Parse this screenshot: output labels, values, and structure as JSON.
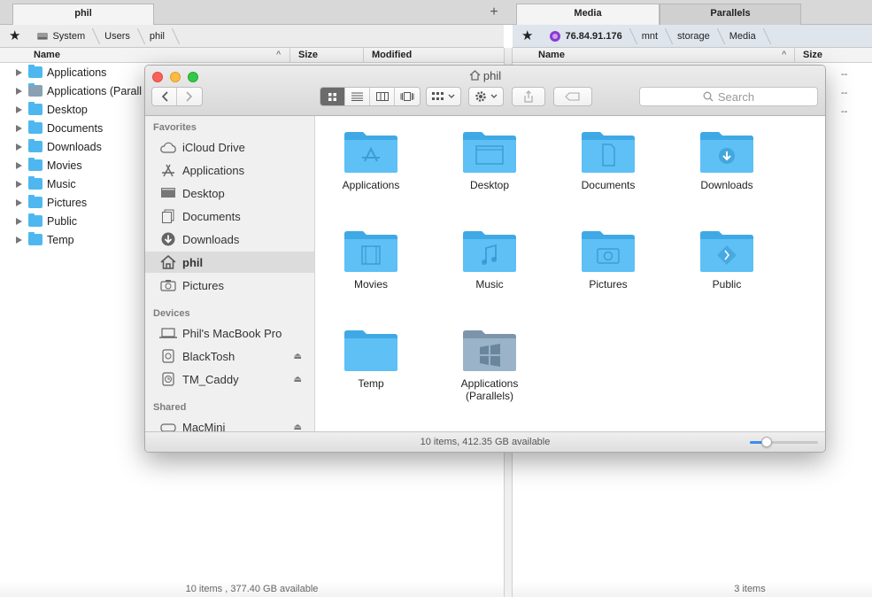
{
  "left_pane": {
    "tab": "phil",
    "path": [
      "System",
      "Users",
      "phil"
    ],
    "columns": [
      "Name",
      "Size",
      "Modified"
    ],
    "items": [
      "Applications",
      "Applications (Parall",
      "Desktop",
      "Documents",
      "Downloads",
      "Movies",
      "Music",
      "Pictures",
      "Public",
      "Temp"
    ],
    "status": "10 items , 377.40 GB available"
  },
  "right_pane": {
    "tabs": [
      "Media",
      "Parallels"
    ],
    "path": [
      "76.84.91.176",
      "mnt",
      "storage",
      "Media"
    ],
    "columns": [
      "Name",
      "Size"
    ],
    "sizes": [
      "--",
      "--",
      "--"
    ],
    "status": "3 items"
  },
  "tab_plus": "+",
  "star": "★",
  "finder": {
    "title": "phil",
    "search_placeholder": "Search",
    "sidebar": {
      "favorites_label": "Favorites",
      "favorites": [
        {
          "label": "iCloud Drive",
          "icon": "cloud-icon"
        },
        {
          "label": "Applications",
          "icon": "apps-icon"
        },
        {
          "label": "Desktop",
          "icon": "desktop-icon"
        },
        {
          "label": "Documents",
          "icon": "documents-icon"
        },
        {
          "label": "Downloads",
          "icon": "downloads-icon"
        },
        {
          "label": "phil",
          "icon": "home-icon"
        },
        {
          "label": "Pictures",
          "icon": "camera-icon"
        }
      ],
      "devices_label": "Devices",
      "devices": [
        "Phil's MacBook Pro",
        "BlackTosh",
        "TM_Caddy"
      ],
      "shared_label": "Shared",
      "shared": [
        "MacMini"
      ]
    },
    "items": [
      "Applications",
      "Desktop",
      "Documents",
      "Downloads",
      "Movies",
      "Music",
      "Pictures",
      "Public",
      "Temp",
      "Applications (Parallels)"
    ],
    "status": "10 items, 412.35 GB available",
    "zoom_level": 0.25,
    "folder_color": "#5ec0f5"
  }
}
